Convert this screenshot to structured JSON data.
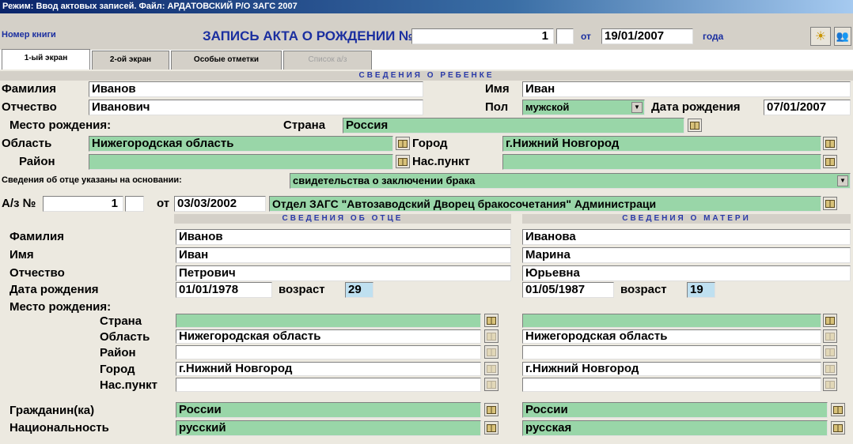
{
  "titlebar": "Режим: Ввод актовых записей. Файл: АРДАТОВСКИЙ Р/О ЗАГС 2007",
  "header": {
    "book_label": "Номер книги",
    "title": "ЗАПИСЬ АКТА О РОЖДЕНИИ №",
    "record_number": "1",
    "from_label": "от",
    "record_date": "19/01/2007",
    "year_label": "года"
  },
  "tabs": [
    {
      "label": "1-ый экран",
      "active": true
    },
    {
      "label": "2-ой экран",
      "active": false
    },
    {
      "label": "Особые отметки",
      "active": false
    },
    {
      "label": "Список а/з",
      "active": false,
      "disabled": true
    }
  ],
  "child": {
    "section_title": "СВЕДЕНИЯ О РЕБЕНКЕ",
    "surname_label": "Фамилия",
    "surname": "Иванов",
    "name_label": "Имя",
    "name": "Иван",
    "patronymic_label": "Отчество",
    "patronymic": "Иванович",
    "sex_label": "Пол",
    "sex": "мужской",
    "dob_label": "Дата рождения",
    "dob": "07/01/2007",
    "birthplace_label": "Место рождения:",
    "country_label": "Страна",
    "country": "Россия",
    "region_label": "Область",
    "region": "Нижегородская область",
    "city_label": "Город",
    "city": "г.Нижний Новгород",
    "district_label": "Район",
    "district": "",
    "settlement_label": "Нас.пункт",
    "settlement": ""
  },
  "father_basis": {
    "label": "Сведения об отце указаны на основании:",
    "value": "свидетельства о заключении брака",
    "act_label": "А/з №",
    "act_number": "1",
    "from_label": "от",
    "act_date": "03/03/2002",
    "issuer": "Отдел ЗАГС \"Автозаводский Дворец бракосочетания\" Администраци"
  },
  "parents": {
    "father_title": "СВЕДЕНИЯ ОБ ОТЦЕ",
    "mother_title": "СВЕДЕНИЯ О МАТЕРИ",
    "labels": {
      "surname": "Фамилия",
      "name": "Имя",
      "patronymic": "Отчество",
      "dob": "Дата рождения",
      "age": "возраст",
      "birthplace": "Место рождения:",
      "country": "Страна",
      "region": "Область",
      "district": "Район",
      "city": "Город",
      "settlement": "Нас.пункт",
      "citizenship": "Гражданин(ка)",
      "nationality": "Национальность"
    },
    "father": {
      "surname": "Иванов",
      "name": "Иван",
      "patronymic": "Петрович",
      "dob": "01/01/1978",
      "age": "29",
      "country": "",
      "region": "Нижегородская область",
      "district": "",
      "city": "г.Нижний Новгород",
      "settlement": "",
      "citizenship": "России",
      "nationality": "русский"
    },
    "mother": {
      "surname": "Иванова",
      "name": "Марина",
      "patronymic": "Юрьевна",
      "dob": "01/05/1987",
      "age": "19",
      "country": "",
      "region": "Нижегородская область",
      "district": "",
      "city": "г.Нижний Новгород",
      "settlement": "",
      "citizenship": "России",
      "nationality": "русская"
    }
  },
  "colors": {
    "lookup_field": "#99d6a8",
    "age_field": "#bfe0f0",
    "title_blue": "#1b2fa0"
  }
}
